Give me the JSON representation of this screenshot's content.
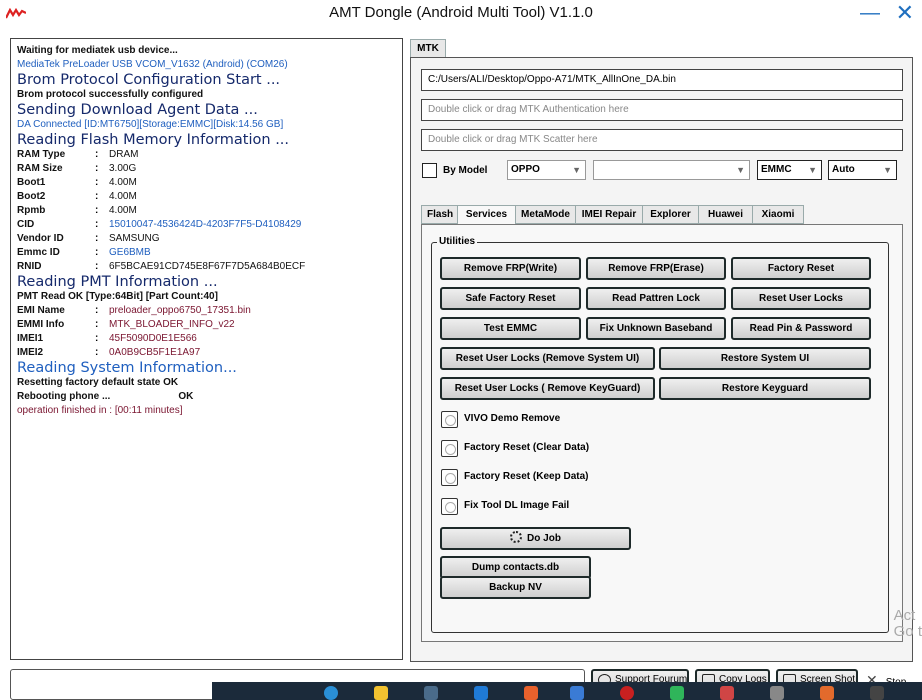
{
  "window": {
    "title": "AMT Dongle (Android Multi Tool) V1.1.0",
    "logo_icon": "app-logo-icon",
    "close_glyph": "✕",
    "minimize_glyph": "—"
  },
  "log": {
    "waiting": "Waiting for mediatek usb device...",
    "port": "MediaTek PreLoader USB VCOM_V1632 (Android) (COM26)",
    "brom_title": "Brom Protocol Configuration Start ...",
    "brom_ok": "Brom protocol successfully configured",
    "da_title": "Sending Download Agent Data ...",
    "da_connected": "DA Connected [ID:MT6750][Storage:EMMC][Disk:14.56 GB]",
    "flash_title": "Reading Flash Memory Information ...",
    "flash_info": [
      {
        "key": "RAM Type",
        "value": "DRAM",
        "color": "normal"
      },
      {
        "key": "RAM Size",
        "value": "3.00G",
        "color": "normal"
      },
      {
        "key": "Boot1",
        "value": "4.00M",
        "color": "normal"
      },
      {
        "key": "Boot2",
        "value": "4.00M",
        "color": "normal"
      },
      {
        "key": "Rpmb",
        "value": "4.00M",
        "color": "normal"
      },
      {
        "key": "CID",
        "value": "15010047-4536424D-4203F7F5-D4108429",
        "color": "blue"
      },
      {
        "key": "Vendor ID",
        "value": "SAMSUNG",
        "color": "normal"
      },
      {
        "key": "Emmc ID",
        "value": "GE6BMB",
        "color": "blue"
      },
      {
        "key": "RNID",
        "value": "6F5BCAE91CD745E8F67F7D5A684B0ECF",
        "color": "normal"
      }
    ],
    "colon": ":",
    "pmt_title": "Reading PMT Information ...",
    "pmt_ok": "PMT Read OK [Type:64Bit] [Part Count:40]",
    "pmt_info": [
      {
        "key": "EMI Name",
        "value": "preloader_oppo6750_17351.bin",
        "color": "maroon"
      },
      {
        "key": "EMMI Info",
        "value": "MTK_BLOADER_INFO_v22",
        "color": "maroon"
      },
      {
        "key": "IMEI1",
        "value": "45F5090D0E1E566",
        "color": "maroon"
      },
      {
        "key": "IMEI2",
        "value": "0A0B9CB5F1E1A97",
        "color": "maroon"
      }
    ],
    "system_title": "Reading System Information...",
    "reset_label": "Resetting factory default state",
    "reset_ok": "OK",
    "reboot_label": "Rebooting phone ...",
    "reboot_ok": "OK",
    "finished": "operation finished in : [00:11 minutes]"
  },
  "mtk": {
    "tab_label": "MTK",
    "da_path": "C:/Users/ALI/Desktop/Oppo-A71/MTK_AllInOne_DA.bin",
    "auth_placeholder": "Double click or drag MTK Authentication here",
    "scatter_placeholder": "Double click or drag MTK Scatter here",
    "by_model_label": "By Model",
    "brand_value": "OPPO",
    "model_value": "",
    "storage_value": "EMMC",
    "mode_value": "Auto",
    "arrow_glyph": "▼"
  },
  "subtabs": [
    "Flash",
    "Services",
    "MetaMode",
    "IMEI Repair",
    "Explorer",
    "Huawei",
    "Xiaomi"
  ],
  "utilities": {
    "group_title": "Utilities",
    "remove_frp_write": "Remove FRP(Write)",
    "remove_frp_erase": "Remove FRP(Erase)",
    "factory_reset": "Factory Reset",
    "safe_factory_reset": "Safe Factory Reset",
    "read_pattern_lock": "Read Pattren Lock",
    "reset_user_locks": "Reset User Locks",
    "test_emmc": "Test EMMC",
    "fix_unknown_baseband": "Fix Unknown Baseband",
    "read_pin_password": "Read Pin & Password",
    "reset_user_locks_system_ui": "Reset User Locks (Remove System UI)",
    "restore_system_ui": "Restore System UI",
    "reset_user_locks_keyguard": "Reset User Locks ( Remove KeyGuard)",
    "restore_keyguard": "Restore Keyguard",
    "options": [
      "VIVO Demo Remove",
      "Factory Reset (Clear Data)",
      "Factory Reset (Keep Data)",
      "Fix Tool DL Image Fail"
    ],
    "do_job": "Do Job",
    "dump_contacts": "Dump contacts.db",
    "backup_nv": "Backup NV"
  },
  "watermark": {
    "line1": "Act",
    "line2": "Go t"
  },
  "bottom": {
    "support_forum": "Support Fourum",
    "copy_logs": "Copy Logs",
    "screen_shot": "Screen Shot",
    "stop": "Stop",
    "stop_glyph": "✕"
  },
  "colors": {
    "accent_blue": "#1f5fbf",
    "heading_navy": "#15296b",
    "maroon": "#7a1530",
    "taskbar": "#1b2a3a"
  }
}
